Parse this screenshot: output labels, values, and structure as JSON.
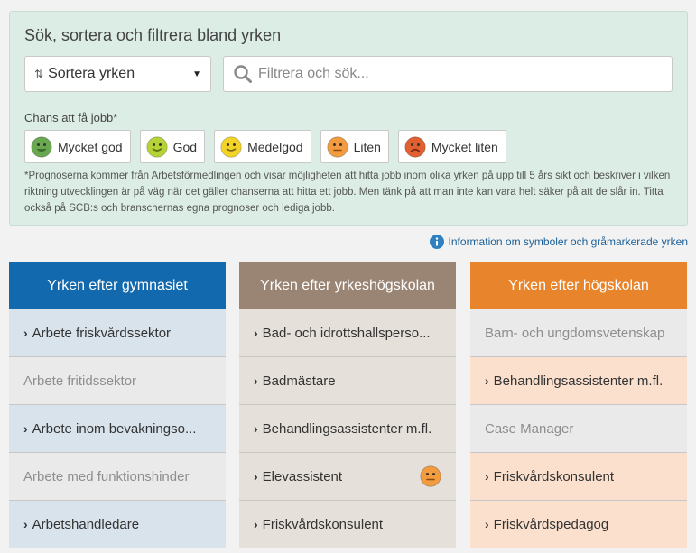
{
  "filters": {
    "title": "Sök, sortera och filtrera bland yrken",
    "sort_label": "Sortera yrken",
    "search_placeholder": "Filtrera och sök...",
    "chance_label": "Chans att få jobb*",
    "chances": [
      {
        "label": "Mycket god",
        "face": "very-good",
        "color": "#6aa84f"
      },
      {
        "label": "God",
        "face": "good",
        "color": "#b5d336"
      },
      {
        "label": "Medelgod",
        "face": "medium",
        "color": "#f2d326"
      },
      {
        "label": "Liten",
        "face": "low",
        "color": "#f29c3f"
      },
      {
        "label": "Mycket liten",
        "face": "very-low",
        "color": "#e2602f"
      }
    ],
    "note": "*Prognoserna kommer från Arbetsförmedlingen och visar möjligheten att hitta jobb inom olika yrken på upp till 5 års sikt och beskriver i vilken riktning utvecklingen är på väg när det gäller chanserna att hitta ett jobb. Men tänk på att man inte kan vara helt säker på att de slår in. Titta också på SCB:s och branschernas egna prognoser och lediga jobb."
  },
  "info_link": "Information om symboler och gråmarkerade yrken",
  "columns": [
    {
      "title": "Yrken efter gymnasiet",
      "header_color": "#1269ad",
      "items": [
        {
          "label": "Arbete friskvårdssektor",
          "active": true
        },
        {
          "label": "Arbete fritidssektor",
          "active": false
        },
        {
          "label": "Arbete inom bevakningso...",
          "active": true
        },
        {
          "label": "Arbete med funktionshinder",
          "active": false
        },
        {
          "label": "Arbetshandledare",
          "active": true
        }
      ]
    },
    {
      "title": "Yrken efter yrkeshögskolan",
      "header_color": "#9a8575",
      "items": [
        {
          "label": "Bad- och idrottshallsperso...",
          "active": true
        },
        {
          "label": "Badmästare",
          "active": true
        },
        {
          "label": "Behandlingsassistenter m.fl.",
          "active": true
        },
        {
          "label": "Elevassistent",
          "active": true,
          "face": "low"
        },
        {
          "label": "Friskvårdskonsulent",
          "active": true
        }
      ]
    },
    {
      "title": "Yrken efter högskolan",
      "header_color": "#e8842b",
      "items": [
        {
          "label": "Barn- och ungdomsvetenskap",
          "active": false
        },
        {
          "label": "Behandlingsassistenter m.fl.",
          "active": true
        },
        {
          "label": "Case Manager",
          "active": false
        },
        {
          "label": "Friskvårdskonsulent",
          "active": true
        },
        {
          "label": "Friskvårdspedagog",
          "active": true
        }
      ]
    }
  ],
  "colors": {
    "panel_bg": "#dcede5",
    "info_icon": "#2f7fc1",
    "col1_active_bg": "#d9e3ec",
    "col2_active_bg": "#e5e0da",
    "col3_active_bg": "#fae0cd",
    "inactive_bg": "#eaeaea"
  }
}
